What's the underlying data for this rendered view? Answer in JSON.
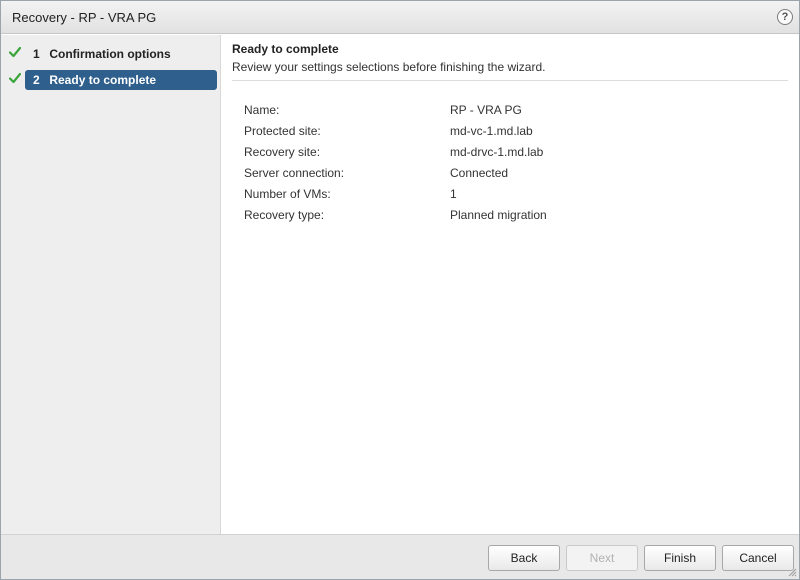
{
  "window": {
    "title": "Recovery - RP - VRA PG",
    "help_icon": "?"
  },
  "sidebar": {
    "steps": [
      {
        "number": "1",
        "label": "Confirmation options",
        "completed": true,
        "active": false
      },
      {
        "number": "2",
        "label": "Ready to complete",
        "completed": true,
        "active": true
      }
    ]
  },
  "main": {
    "heading": "Ready to complete",
    "subheading": "Review your settings selections before finishing the wizard.",
    "summary": [
      {
        "key": "Name:",
        "value": "RP - VRA PG"
      },
      {
        "key": "Protected site:",
        "value": "md-vc-1.md.lab"
      },
      {
        "key": "Recovery site:",
        "value": "md-drvc-1.md.lab"
      },
      {
        "key": "Server connection:",
        "value": "Connected"
      },
      {
        "key": "Number of VMs:",
        "value": "1"
      },
      {
        "key": "Recovery type:",
        "value": "Planned migration"
      }
    ]
  },
  "footer": {
    "back_label": "Back",
    "next_label": "Next",
    "finish_label": "Finish",
    "cancel_label": "Cancel",
    "next_disabled": true
  },
  "colors": {
    "active_step": "#2f5f8c",
    "check": "#3aa53a",
    "sidebar_bg": "#eeeeee",
    "footer_bg": "#e8e8e8"
  }
}
